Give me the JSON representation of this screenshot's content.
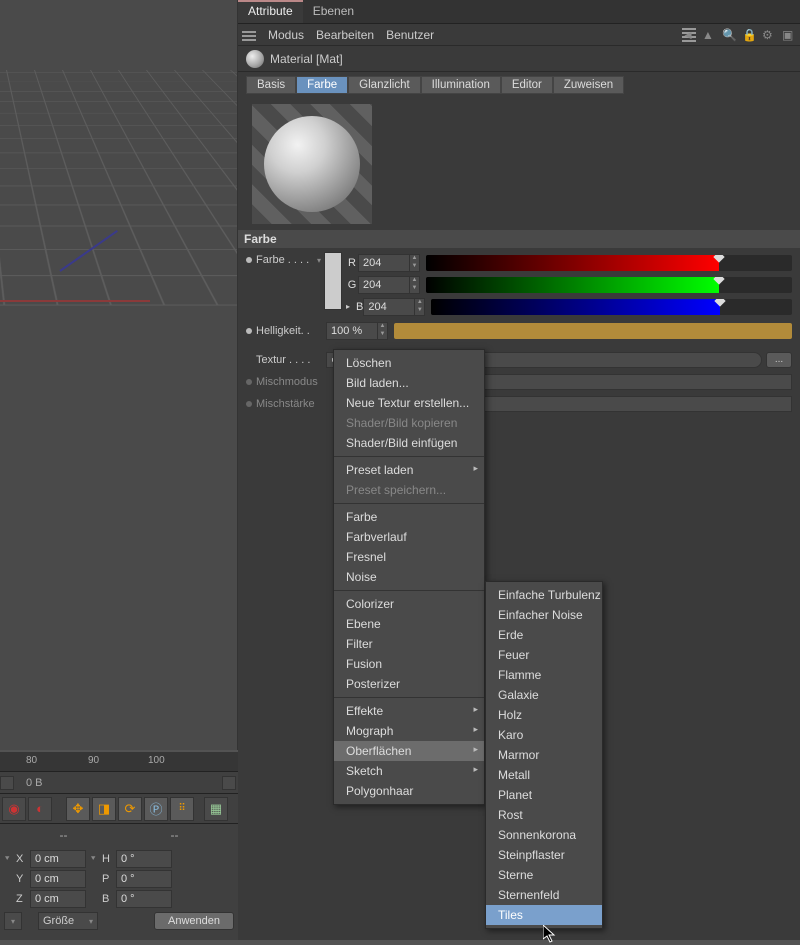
{
  "tabs": {
    "left": "Attribute",
    "right": "Ebenen"
  },
  "menus": {
    "mode": "Modus",
    "edit": "Bearbeiten",
    "user": "Benutzer"
  },
  "object": "Material [Mat]",
  "channels": [
    "Basis",
    "Farbe",
    "Glanzlicht",
    "Illumination",
    "Editor",
    "Zuweisen"
  ],
  "channels_active_index": 1,
  "section": "Farbe",
  "params": {
    "color_label": "Farbe",
    "r_label": "R",
    "g_label": "G",
    "b_label": "B",
    "r": "204",
    "g": "204",
    "b": "204",
    "brightness_label": "Helligkeit",
    "brightness": "100 %",
    "texture_label": "Textur",
    "mixmode_label": "Mischmodus",
    "mixstrength_label": "Mischstärke"
  },
  "texture_button": "...",
  "ctx_menu": {
    "items": [
      {
        "label": "Löschen"
      },
      {
        "label": "Bild laden..."
      },
      {
        "label": "Neue Textur erstellen..."
      },
      {
        "label": "Shader/Bild kopieren",
        "disabled": true
      },
      {
        "label": "Shader/Bild einfügen"
      },
      {
        "label": "Preset laden",
        "sep": true,
        "sub": true
      },
      {
        "label": "Preset speichern...",
        "disabled": true
      },
      {
        "label": "Farbe",
        "sep": true
      },
      {
        "label": "Farbverlauf"
      },
      {
        "label": "Fresnel"
      },
      {
        "label": "Noise"
      },
      {
        "label": "Colorizer",
        "sep": true
      },
      {
        "label": "Ebene"
      },
      {
        "label": "Filter"
      },
      {
        "label": "Fusion"
      },
      {
        "label": "Posterizer"
      },
      {
        "label": "Effekte",
        "sep": true,
        "sub": true
      },
      {
        "label": "Mograph",
        "sub": true
      },
      {
        "label": "Oberflächen",
        "sub": true,
        "hover": true
      },
      {
        "label": "Sketch",
        "sub": true
      },
      {
        "label": "Polygonhaar"
      }
    ]
  },
  "sub_menu": {
    "items": [
      "Einfache Turbulenz",
      "Einfacher Noise",
      "Erde",
      "Feuer",
      "Flamme",
      "Galaxie",
      "Holz",
      "Karo",
      "Marmor",
      "Metall",
      "Planet",
      "Rost",
      "Sonnenkorona",
      "Steinpflaster",
      "Sterne",
      "Sternenfeld",
      "Tiles"
    ],
    "selected_index": 16
  },
  "timeline": {
    "tick80": "80",
    "tick90": "90",
    "tick100": "100",
    "frame": "0 B",
    "dash": "--",
    "axes": {
      "x": "X",
      "y": "Y",
      "z": "Z",
      "h": "H",
      "p": "P",
      "b": "B",
      "zero_cm": "0 cm",
      "zero_deg": "0 °"
    },
    "size": "Größe",
    "apply": "Anwenden"
  }
}
